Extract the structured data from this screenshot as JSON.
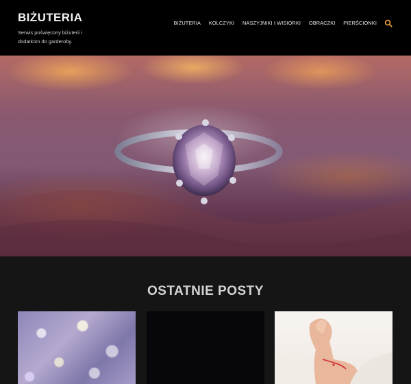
{
  "site": {
    "title": "BIŻUTERIA",
    "tagline": "Serwis poświęcony biżuterii i dodatkom do garderoby."
  },
  "nav": {
    "items": [
      "BIŻUTERIA",
      "KOLCZYKI",
      "NASZYJNIKI I WISIORKI",
      "OBRĄCZKI",
      "PIERŚCIONKI"
    ],
    "search_icon": "search-icon"
  },
  "hero": {
    "image": "diamond-ring-photo"
  },
  "posts": {
    "heading": "OSTATNIE POSTY",
    "cards": [
      {
        "image": "sparkle-bokeh-photo"
      },
      {
        "image": "dark-photo"
      },
      {
        "image": "bracelet-wrist-photo"
      }
    ]
  },
  "colors": {
    "header_bg": "#000000",
    "page_bg": "#151515",
    "accent": "#f0a63a"
  }
}
